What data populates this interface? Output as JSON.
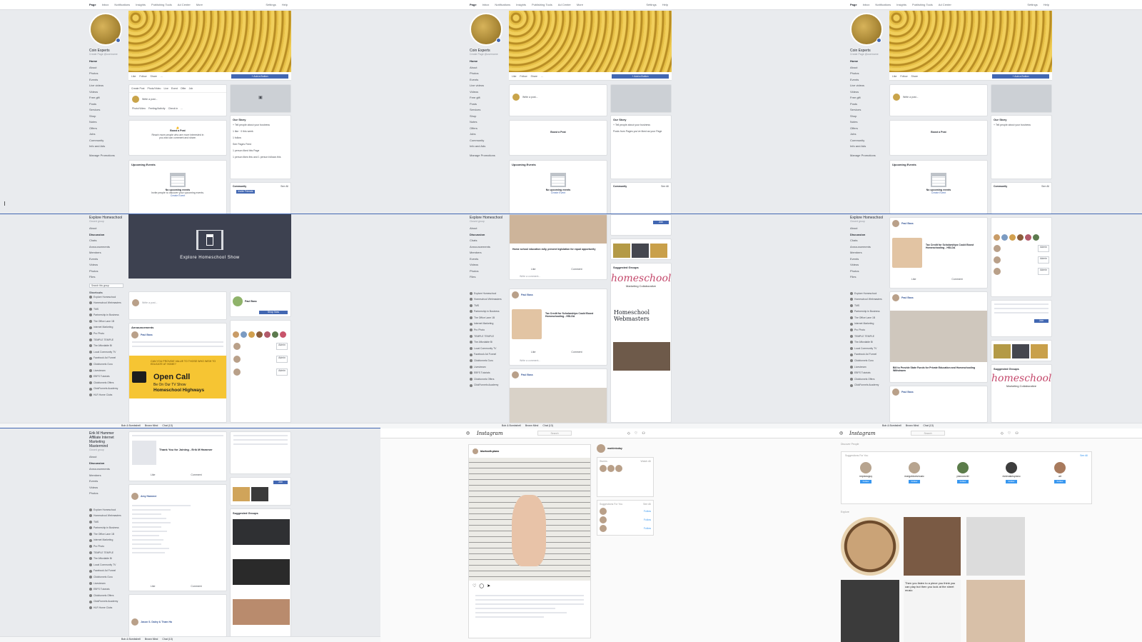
{
  "fb_topbar": {
    "tabs": [
      "Page",
      "Inbox",
      "Notifications",
      "Insights",
      "Publishing Tools",
      "Ad Center",
      "More"
    ],
    "right": [
      "Settings",
      "Help"
    ]
  },
  "coin_page": {
    "name": "Coin Experts",
    "subtitle": "Create Page @username",
    "nav": [
      "Home",
      "About",
      "Photos",
      "Events",
      "Live videos",
      "Videos",
      "Free gift",
      "Posts",
      "Services",
      "Shop",
      "Notes",
      "Offers",
      "Jobs",
      "Community",
      "Info and Ads"
    ],
    "manage_promotions": "Manage Promotions",
    "actions": [
      "Like",
      "Follow",
      "Share",
      "..."
    ],
    "cta": "+ Add a Button",
    "composer_tabs": [
      "Create Post",
      "Photo/Video",
      "Live",
      "Event",
      "Offer",
      "Job"
    ],
    "composer_placeholder": "Write a post...",
    "composer_chips": [
      "Photo/Video",
      "Feeling/Activity",
      "Check in",
      "..."
    ],
    "boost_title": "Boost a Post",
    "boost_text": "Reach more people who are more interested in you and can comment and share.",
    "upcoming_events": "Upcoming Events",
    "no_events": "No upcoming events",
    "no_events_sub": "Invite people to discover your upcoming events.",
    "create_event": "Create Event",
    "our_story": "Our Story",
    "story_line": "+ Tell people about your business",
    "about_items": [
      "1 like · 0 this week",
      "1 follow",
      "See Pages Feed",
      "Posts from Pages you've liked as your Page",
      "1 person liked this Page",
      "1 person likes this and 1 person follows this"
    ],
    "community": "Community",
    "see_all": "See All",
    "invite": "Invite Friends"
  },
  "group": {
    "name": "Explore Homeschool",
    "type": "Closed group",
    "banner_text": "Explore Homeschool Show",
    "nav": [
      "About",
      "Discussion",
      "Chats",
      "Announcements",
      "Members",
      "Events",
      "Videos",
      "Photos",
      "Files"
    ],
    "search_placeholder": "Search this group",
    "shortcuts_title": "Shortcuts",
    "shortcuts": [
      "Explore Homeschool",
      "Homeschool Webmasters",
      "TMS",
      "Partnership in Business",
      "The Office Lane 1B",
      "Internet Marketing",
      "Pro Photo",
      "TEMPLE TEMPLE",
      "The Affordable Bi",
      "Local Community TV",
      "Facebook Ad Funnel",
      "Clickfunnels Guru",
      "Livestream",
      "EBFS Tutorials",
      "Clickfunnels Offers",
      "ClickFunnels Academy",
      "HLR Home Clubs"
    ],
    "announcements": "Announcements",
    "author": "Paul Bass",
    "open_call_small": "CAN YOU PROVIDE VALUE TO THOSE WHO WISH TO EDUCATE AT HOME?",
    "open_call": "Open Call",
    "open_call_sub1": "Be On Our TV Show",
    "open_call_sub2": "Homeschool Highways",
    "post_title_1": "Home school education rally, present legislation for equal opportunity",
    "post_title_2": "Tax Credit for Scholarships Could Boost Homeschooling - HSLDA",
    "post_title_3": "Bill to Provide State Funds for Private Education and Homeschooling Withdrawn",
    "like": "Like",
    "comment": "Comment",
    "write_comment": "Write a comment...",
    "suggested_groups": "Suggested Groups",
    "hs_logo": "homeschool",
    "hs_logo_sub": "Marketing Collaborative",
    "hs_webmasters": "Homeschool Webmasters",
    "join": "Join",
    "shop_now": "Shop Now",
    "members_label": "Admin"
  },
  "mastermind": {
    "name": "Erik M Hammer Affiliate Internet Marketing Mastermind",
    "type": "Closed group",
    "nav": [
      "About",
      "Discussion",
      "Announcements",
      "Members",
      "Events",
      "Videos",
      "Photos"
    ],
    "post_thanks": "Thank You for Joining - Erik M Hammer",
    "commenter": "Amy Hammer",
    "reply_author": "Jason S. Daley & Tham Ha"
  },
  "dock": [
    "Bob & Bombshell",
    "Brown Mind",
    "Chat (13)"
  ],
  "instagram": {
    "logo": "Instagram",
    "search": "Search",
    "post_user": "bluetooth.piano",
    "side_user": "markintoday",
    "stories": "Stories",
    "watch_all": "Watch All",
    "suggestions": "Suggestions For You",
    "see_all": "See All",
    "suggested_people": [
      "mrpianoguy",
      "margotdoesmusic",
      "pianoworld",
      "nickmakespiano",
      "art"
    ],
    "follow": "Follow",
    "discover": "Discover People",
    "explore_label": "Explore",
    "overlay_caption": "Then you listen to a piece you think you can play but then you look at the sheet music"
  },
  "colors": {
    "fb_blue": "#4267b2",
    "fb_bg": "#e9ebee",
    "gold": "#d4ad3d",
    "open_call_yellow": "#f6c533",
    "ig_blue": "#3897f0"
  }
}
